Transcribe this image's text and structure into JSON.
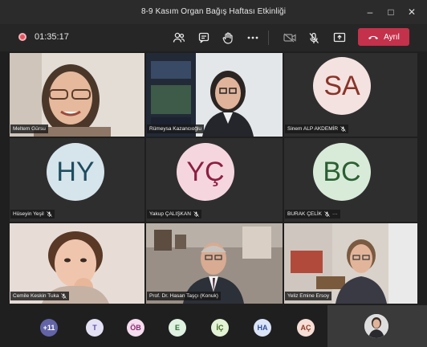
{
  "window": {
    "title": "8-9 Kasım Organ Bağış Haftası Etkinliği",
    "controls": {
      "minimize": "–",
      "maximize": "□",
      "close": "✕"
    }
  },
  "toolbar": {
    "timer": "01:35:17",
    "leave_label": "Ayrıl",
    "leave_color": "#c4314b",
    "icons": [
      "participants-icon",
      "chat-icon",
      "raise-hand-icon",
      "more-icon",
      "camera-off-icon",
      "mic-off-icon",
      "share-icon",
      "phone-icon"
    ]
  },
  "participants": [
    {
      "name": "Meltem Gürsu",
      "type": "video",
      "muted": false
    },
    {
      "name": "Rümeysa Kazancıoğlu",
      "type": "video",
      "muted": false
    },
    {
      "name": "Sinem ALP AKDEMİR",
      "type": "avatar",
      "initials": "SA",
      "bg": "#f4e2e0",
      "fg": "#8a3328",
      "muted": true
    },
    {
      "name": "Hüseyin Yeşil",
      "type": "avatar",
      "initials": "HY",
      "bg": "#d6e5eb",
      "fg": "#1e4d60",
      "muted": true
    },
    {
      "name": "Yakup ÇALIŞKAN",
      "type": "avatar",
      "initials": "YÇ",
      "bg": "#f5d6df",
      "fg": "#8c1f41",
      "muted": true
    },
    {
      "name": "BURAK ÇELİK",
      "type": "avatar",
      "initials": "BC",
      "bg": "#d8ebd9",
      "fg": "#2a5f32",
      "muted": true
    },
    {
      "name": "Cemile Keskin Tuka",
      "type": "video",
      "muted": true
    },
    {
      "name": "Prof. Dr. Hasan Taşçı (Konuk)",
      "type": "video",
      "muted": false
    },
    {
      "name": "Yeliz Emine Ersoy",
      "type": "video",
      "muted": false
    }
  ],
  "overflow_bubbles": [
    {
      "label": "+11",
      "bg": "#6264a7",
      "fg": "#ffffff"
    },
    {
      "label": "T",
      "bg": "#e4e1f5",
      "fg": "#5a4fa8"
    },
    {
      "label": "ÖB",
      "bg": "#f5dcef",
      "fg": "#8c2a70"
    },
    {
      "label": "E",
      "bg": "#dff1e1",
      "fg": "#2b6b35"
    },
    {
      "label": "İÇ",
      "bg": "#e3f3d6",
      "fg": "#3d6a1e"
    },
    {
      "label": "HA",
      "bg": "#dbe4f7",
      "fg": "#2f4f95"
    },
    {
      "label": "AÇ",
      "bg": "#f6ddd6",
      "fg": "#8a3a22"
    }
  ],
  "tray_more": "···"
}
